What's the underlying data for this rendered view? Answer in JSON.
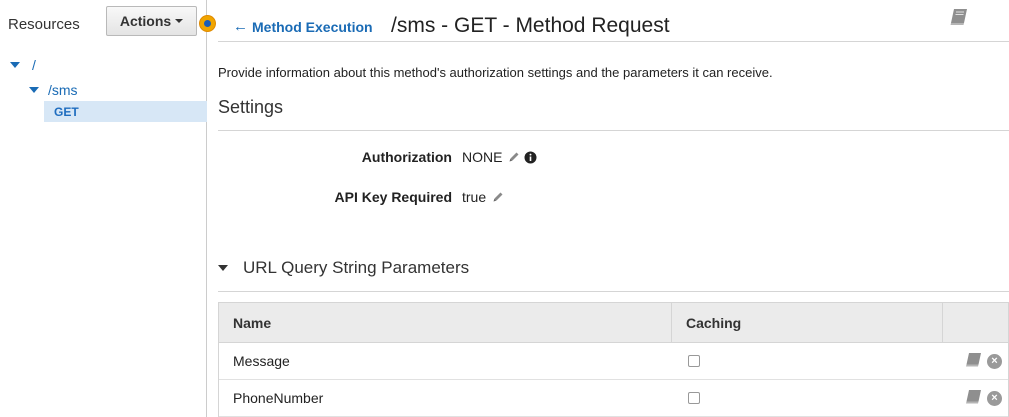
{
  "sidebar": {
    "resources_label": "Resources",
    "actions_label": "Actions",
    "tree": [
      {
        "label": "/"
      },
      {
        "label": "/sms"
      },
      {
        "label": "GET"
      }
    ]
  },
  "header": {
    "back_label": "Method Execution",
    "title": "/sms - GET - Method Request"
  },
  "description": "Provide information about this method's authorization settings and the parameters it can receive.",
  "settings": {
    "heading": "Settings",
    "authorization_label": "Authorization",
    "authorization_value": "NONE",
    "api_key_label": "API Key Required",
    "api_key_value": "true"
  },
  "query_params": {
    "heading": "URL Query String Parameters",
    "columns": [
      "Name",
      "Caching",
      ""
    ],
    "rows": [
      {
        "name": "Message",
        "caching": false
      },
      {
        "name": "PhoneNumber",
        "caching": false
      }
    ]
  },
  "colors": {
    "link": "#1a6bb5",
    "selected_bg": "#d7e7f6",
    "status_dot": "#f0a500"
  }
}
